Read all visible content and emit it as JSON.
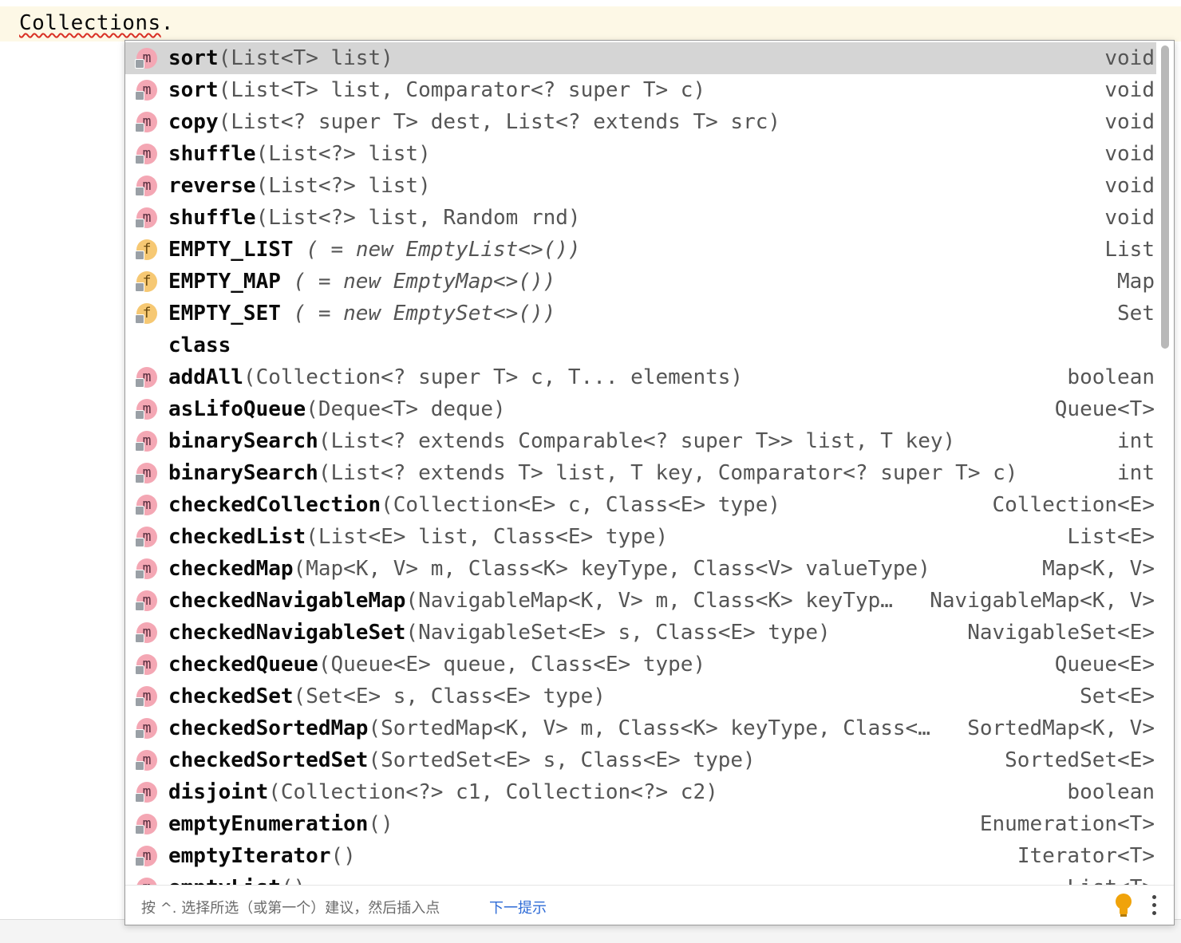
{
  "editor": {
    "identifier": "Collections",
    "dot": "."
  },
  "completion": {
    "items": [
      {
        "icon": "method",
        "icon_letter": "m",
        "name": "sort",
        "sig": "(List<T> list)",
        "italic": false,
        "ret": "void",
        "selected": true
      },
      {
        "icon": "method",
        "icon_letter": "m",
        "name": "sort",
        "sig": "(List<T> list, Comparator<? super T> c)",
        "italic": false,
        "ret": "void",
        "selected": false
      },
      {
        "icon": "method",
        "icon_letter": "m",
        "name": "copy",
        "sig": "(List<? super T> dest, List<? extends T> src)",
        "italic": false,
        "ret": "void",
        "selected": false
      },
      {
        "icon": "method",
        "icon_letter": "m",
        "name": "shuffle",
        "sig": "(List<?> list)",
        "italic": false,
        "ret": "void",
        "selected": false
      },
      {
        "icon": "method",
        "icon_letter": "m",
        "name": "reverse",
        "sig": "(List<?> list)",
        "italic": false,
        "ret": "void",
        "selected": false
      },
      {
        "icon": "method",
        "icon_letter": "m",
        "name": "shuffle",
        "sig": "(List<?> list, Random rnd)",
        "italic": false,
        "ret": "void",
        "selected": false
      },
      {
        "icon": "field",
        "icon_letter": "f",
        "name": "EMPTY_LIST",
        "sig": " ( = new EmptyList<>())",
        "italic": true,
        "ret": "List",
        "selected": false
      },
      {
        "icon": "field",
        "icon_letter": "f",
        "name": "EMPTY_MAP",
        "sig": " ( = new EmptyMap<>())",
        "italic": true,
        "ret": "Map",
        "selected": false
      },
      {
        "icon": "field",
        "icon_letter": "f",
        "name": "EMPTY_SET",
        "sig": " ( = new EmptySet<>())",
        "italic": true,
        "ret": "Set",
        "selected": false
      },
      {
        "icon": "none",
        "icon_letter": "",
        "name": "class",
        "sig": "",
        "italic": false,
        "ret": "",
        "selected": false
      },
      {
        "icon": "method",
        "icon_letter": "m",
        "name": "addAll",
        "sig": "(Collection<? super T> c, T... elements)",
        "italic": false,
        "ret": "boolean",
        "selected": false
      },
      {
        "icon": "method",
        "icon_letter": "m",
        "name": "asLifoQueue",
        "sig": "(Deque<T> deque)",
        "italic": false,
        "ret": "Queue<T>",
        "selected": false
      },
      {
        "icon": "method",
        "icon_letter": "m",
        "name": "binarySearch",
        "sig": "(List<? extends Comparable<? super T>> list, T key)",
        "italic": false,
        "ret": "int",
        "selected": false
      },
      {
        "icon": "method",
        "icon_letter": "m",
        "name": "binarySearch",
        "sig": "(List<? extends T> list, T key, Comparator<? super T> c)",
        "italic": false,
        "ret": "int",
        "selected": false
      },
      {
        "icon": "method",
        "icon_letter": "m",
        "name": "checkedCollection",
        "sig": "(Collection<E> c, Class<E> type)",
        "italic": false,
        "ret": "Collection<E>",
        "selected": false
      },
      {
        "icon": "method",
        "icon_letter": "m",
        "name": "checkedList",
        "sig": "(List<E> list, Class<E> type)",
        "italic": false,
        "ret": "List<E>",
        "selected": false
      },
      {
        "icon": "method",
        "icon_letter": "m",
        "name": "checkedMap",
        "sig": "(Map<K, V> m, Class<K> keyType, Class<V> valueType)",
        "italic": false,
        "ret": "Map<K, V>",
        "selected": false
      },
      {
        "icon": "method",
        "icon_letter": "m",
        "name": "checkedNavigableMap",
        "sig": "(NavigableMap<K, V> m, Class<K> keyTyp…",
        "italic": false,
        "ret": "NavigableMap<K, V>",
        "selected": false
      },
      {
        "icon": "method",
        "icon_letter": "m",
        "name": "checkedNavigableSet",
        "sig": "(NavigableSet<E> s, Class<E> type)",
        "italic": false,
        "ret": "NavigableSet<E>",
        "selected": false
      },
      {
        "icon": "method",
        "icon_letter": "m",
        "name": "checkedQueue",
        "sig": "(Queue<E> queue, Class<E> type)",
        "italic": false,
        "ret": "Queue<E>",
        "selected": false
      },
      {
        "icon": "method",
        "icon_letter": "m",
        "name": "checkedSet",
        "sig": "(Set<E> s, Class<E> type)",
        "italic": false,
        "ret": "Set<E>",
        "selected": false
      },
      {
        "icon": "method",
        "icon_letter": "m",
        "name": "checkedSortedMap",
        "sig": "(SortedMap<K, V> m, Class<K> keyType, Class<…",
        "italic": false,
        "ret": "SortedMap<K, V>",
        "selected": false
      },
      {
        "icon": "method",
        "icon_letter": "m",
        "name": "checkedSortedSet",
        "sig": "(SortedSet<E> s, Class<E> type)",
        "italic": false,
        "ret": "SortedSet<E>",
        "selected": false
      },
      {
        "icon": "method",
        "icon_letter": "m",
        "name": "disjoint",
        "sig": "(Collection<?> c1, Collection<?> c2)",
        "italic": false,
        "ret": "boolean",
        "selected": false
      },
      {
        "icon": "method",
        "icon_letter": "m",
        "name": "emptyEnumeration",
        "sig": "()",
        "italic": false,
        "ret": "Enumeration<T>",
        "selected": false
      },
      {
        "icon": "method",
        "icon_letter": "m",
        "name": "emptyIterator",
        "sig": "()",
        "italic": false,
        "ret": "Iterator<T>",
        "selected": false
      },
      {
        "icon": "method",
        "icon_letter": "m",
        "name": "emptyList",
        "sig": "()",
        "italic": false,
        "ret": "List<T>",
        "selected": false
      }
    ],
    "footer": {
      "hint": "按 ^. 选择所选（或第一个）建议，然后插入点",
      "next_tip": "下一提示"
    },
    "icons": {
      "method": "method-icon",
      "field": "field-icon",
      "bulb": "lightbulb-icon",
      "more": "more-vertical-icon"
    },
    "colors": {
      "method_icon": "#f4a7b4",
      "field_icon": "#f6c873",
      "selection": "#d5d5d5",
      "link": "#2e6bd6",
      "bulb": "#f0a30a"
    }
  }
}
